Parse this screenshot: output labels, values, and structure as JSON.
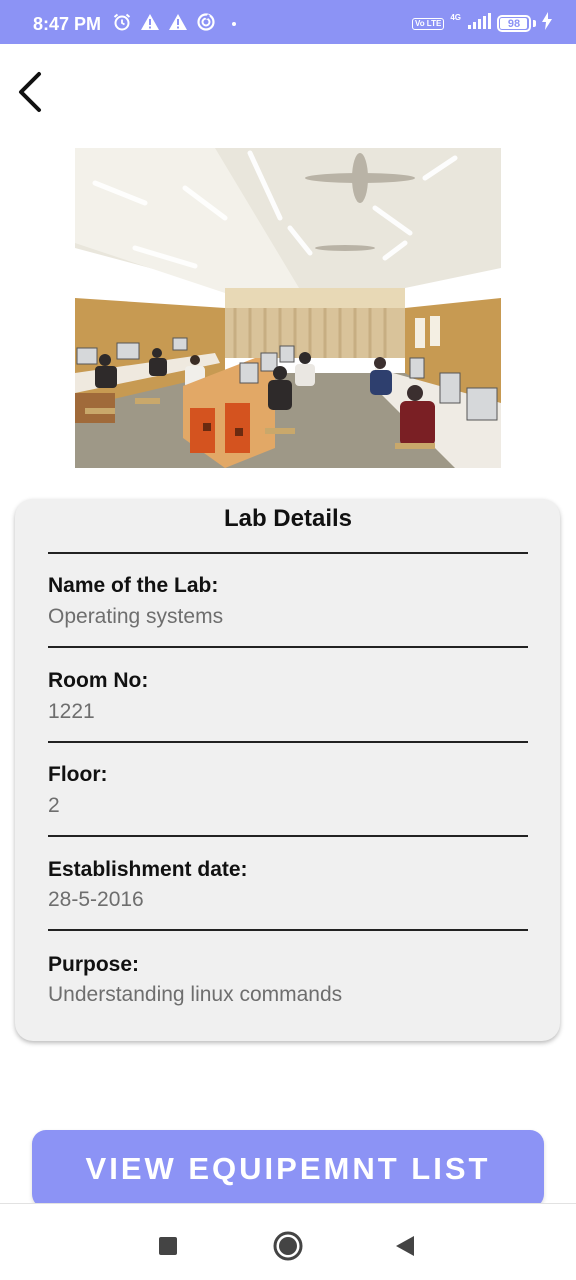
{
  "status_bar": {
    "time": "8:47 PM",
    "icons_left": [
      "alarm-icon",
      "warning-icon",
      "warning-icon",
      "data-saver-icon",
      "dot-icon"
    ],
    "network_volte": "Vo LTE",
    "network_type": "4G",
    "battery_level": "98",
    "bg_color": "#8C93F5"
  },
  "header": {
    "back_icon": "back-arrow-icon"
  },
  "lab_image": {
    "description_icon": "computer-lab-photo"
  },
  "card": {
    "title": "Lab Details",
    "fields": [
      {
        "label": "Name of the Lab:",
        "value": "Operating systems"
      },
      {
        "label": "Room No:",
        "value": "1221"
      },
      {
        "label": "Floor:",
        "value": "2"
      },
      {
        "label": "Establishment date:",
        "value": "28-5-2016"
      },
      {
        "label": "Purpose:",
        "value": "Understanding linux commands"
      }
    ]
  },
  "actions": {
    "view_list_label": "VIEW EQUIPEMNT LIST",
    "accent_color": "#8C93F5"
  },
  "nav_bar": {
    "recents_icon": "square-icon",
    "home_icon": "circle-icon",
    "back_icon": "triangle-back-icon"
  }
}
